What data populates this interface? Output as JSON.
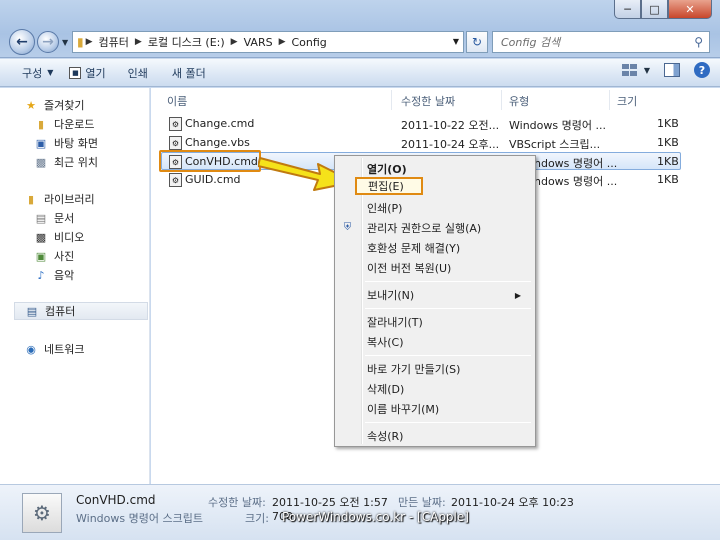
{
  "window": {
    "controls": {
      "minimize": "─",
      "maximize": "□",
      "close": "✕"
    }
  },
  "address": {
    "crumbs": [
      "컴퓨터",
      "로컬 디스크 (E:)",
      "VARS",
      "Config"
    ]
  },
  "search": {
    "placeholder": "Config 검색"
  },
  "toolbar": {
    "organize": "구성",
    "open": "열기",
    "print": "인쇄",
    "new_folder": "새 폴더"
  },
  "sidebar": {
    "favorites": "즐겨찾기",
    "favorites_items": [
      "다운로드",
      "바탕 화면",
      "최근 위치"
    ],
    "libraries": "라이브러리",
    "library_items": [
      "문서",
      "비디오",
      "사진",
      "음악"
    ],
    "computer": "컴퓨터",
    "network": "네트워크"
  },
  "columns": {
    "name": "이름",
    "modified": "수정한 날짜",
    "type": "유형",
    "size": "크기"
  },
  "files": [
    {
      "name": "Change.cmd",
      "modified": "2011-10-22 오전...",
      "type": "Windows 명령어 ...",
      "size": "1KB"
    },
    {
      "name": "Change.vbs",
      "modified": "2011-10-24 오후...",
      "type": "VBScript 스크립...",
      "size": "1KB"
    },
    {
      "name": "ConVHD.cmd",
      "modified": "",
      "type": "ndows 명령어 ...",
      "size": "1KB"
    },
    {
      "name": "GUID.cmd",
      "modified": "",
      "type": "ndows 명령어 ...",
      "size": "1KB"
    }
  ],
  "context_menu": {
    "open": "열기(O)",
    "edit": "편집(E)",
    "print": "인쇄(P)",
    "run_as_admin": "관리자 권한으로 실행(A)",
    "troubleshoot": "호환성 문제 해결(Y)",
    "restore": "이전 버전 복원(U)",
    "send_to": "보내기(N)",
    "cut": "잘라내기(T)",
    "copy": "복사(C)",
    "shortcut": "바로 가기 만들기(S)",
    "delete": "삭제(D)",
    "rename": "이름 바꾸기(M)",
    "properties": "속성(R)"
  },
  "status": {
    "filename": "ConVHD.cmd",
    "filetype": "Windows 명령어 스크립트",
    "modified_label": "수정한 날짜:",
    "modified_value": "2011-10-25 오전 1:57",
    "created_label": "만든 날짜:",
    "created_value": "2011-10-24 오후 10:23",
    "size_label": "크기:",
    "size_value": "700"
  },
  "watermark": "PowerWindows.co.kr - [CApple]",
  "colors": {
    "highlight_border": "#e08a12",
    "arrow_fill": "#f5e21a",
    "selection": "#d5e6f9"
  }
}
